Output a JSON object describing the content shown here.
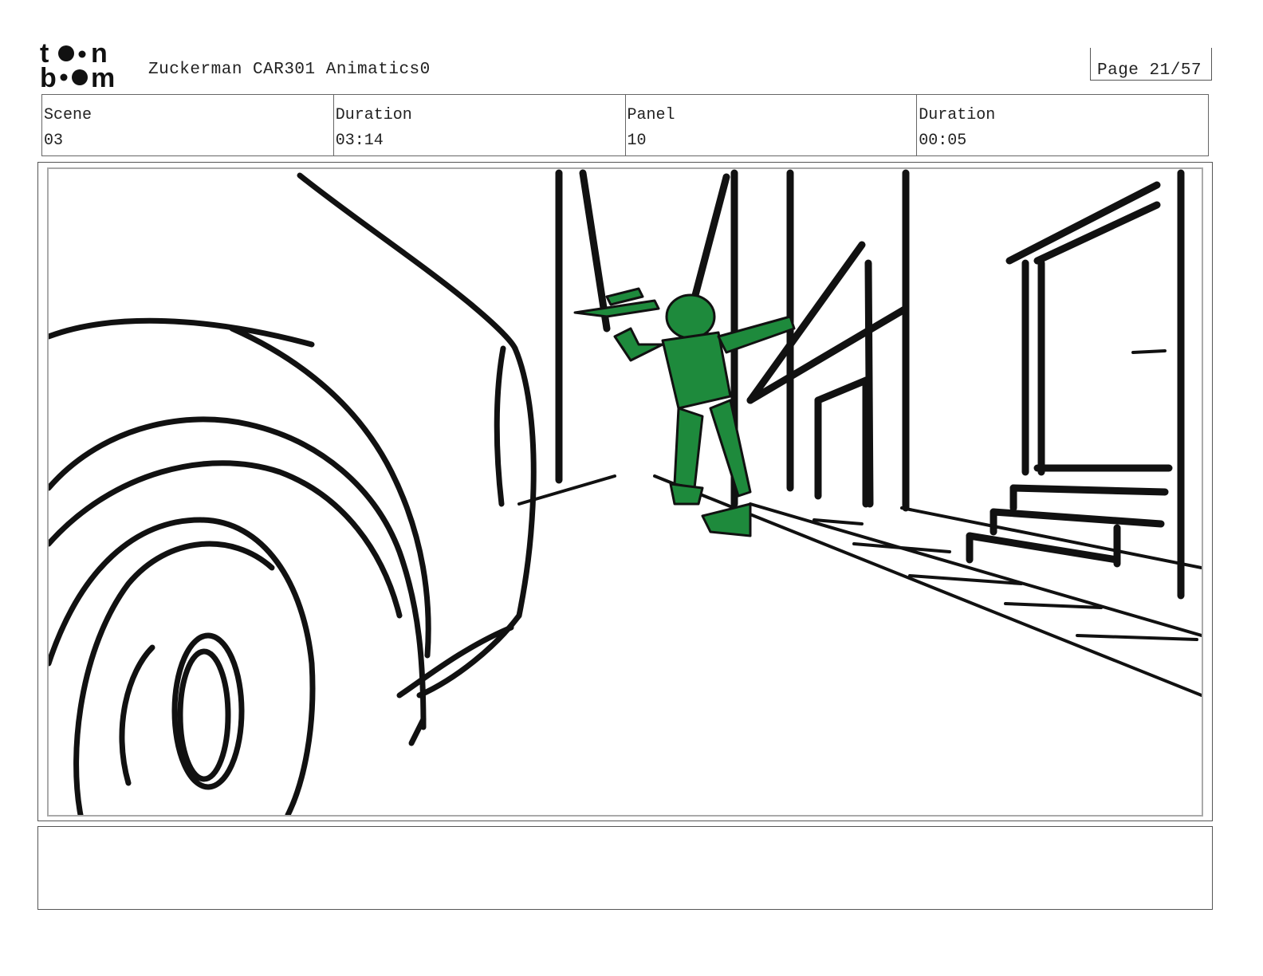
{
  "header": {
    "logo_text": "toon boom",
    "title": "Zuckerman CAR301 Animatics0",
    "page": "Page 21/57"
  },
  "info": {
    "scene_label": "Scene",
    "scene_value": "03",
    "scene_duration_label": "Duration",
    "scene_duration_value": "03:14",
    "panel_label": "Panel",
    "panel_value": "10",
    "panel_duration_label": "Duration",
    "panel_duration_value": "00:05"
  },
  "panel": {
    "figure_color": "#1e8a3c",
    "line_color": "#111111"
  },
  "notes": {
    "text": ""
  }
}
